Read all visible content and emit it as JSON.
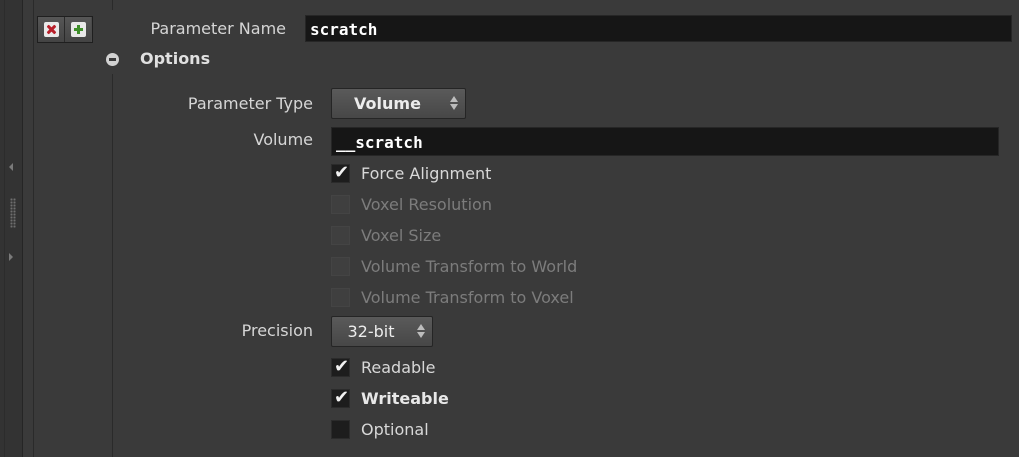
{
  "parameter_name": {
    "label": "Parameter Name",
    "value": "scratch"
  },
  "buttons": {
    "remove_icon": "close-icon",
    "add_icon": "plus-icon"
  },
  "options": {
    "title": "Options",
    "parameter_type": {
      "label": "Parameter Type",
      "selected": "Volume"
    },
    "volume": {
      "label": "Volume",
      "value": "__scratch"
    },
    "checkboxes": [
      {
        "label": "Force Alignment",
        "checked": true,
        "enabled": true
      },
      {
        "label": "Voxel Resolution",
        "checked": false,
        "enabled": false
      },
      {
        "label": "Voxel Size",
        "checked": false,
        "enabled": false
      },
      {
        "label": "Volume Transform to World",
        "checked": false,
        "enabled": false
      },
      {
        "label": "Volume Transform to Voxel",
        "checked": false,
        "enabled": false
      }
    ],
    "precision": {
      "label": "Precision",
      "selected": "32-bit"
    },
    "flags": [
      {
        "label": "Readable",
        "checked": true
      },
      {
        "label": "Writeable",
        "checked": true
      },
      {
        "label": "Optional",
        "checked": false
      }
    ]
  },
  "colors": {
    "background": "#3a3a3a",
    "field_background": "#161616",
    "remove_accent": "#b81f2a",
    "add_accent": "#3f8f2a"
  }
}
